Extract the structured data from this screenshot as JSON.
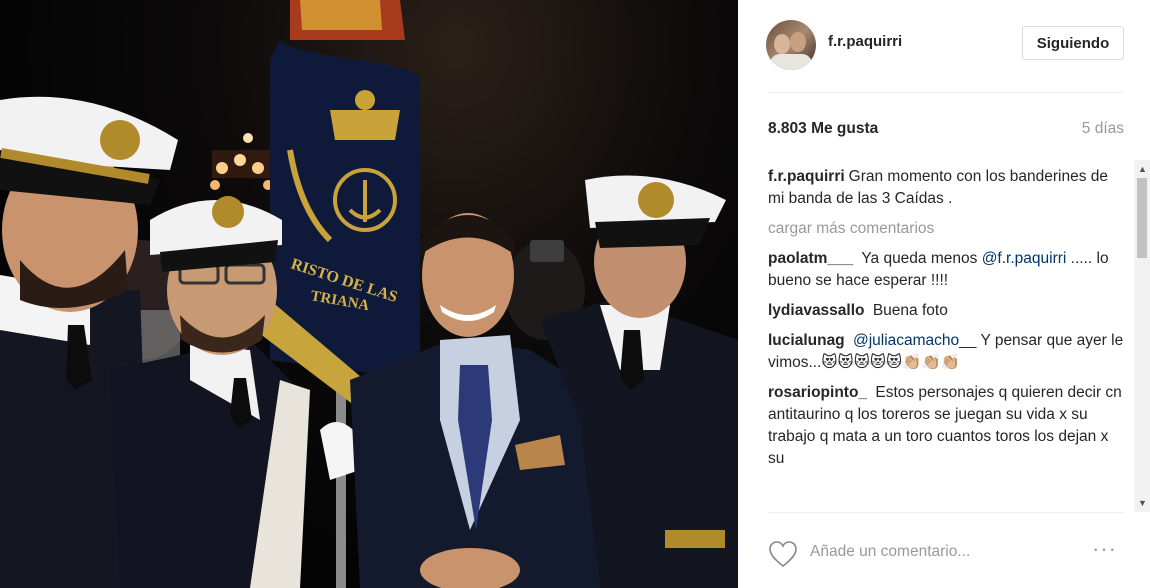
{
  "post": {
    "username": "f.r.paquirri",
    "follow_label": "Siguiendo",
    "likes": "8.803 Me gusta",
    "time": "5 días"
  },
  "caption": {
    "user": "f.r.paquirri",
    "text": "Gran momento con los banderines de mi banda de las 3 Caídas ."
  },
  "load_more": "cargar más comentarios",
  "comments": [
    {
      "user": "paolatm___",
      "before": "Ya queda menos",
      "mention": "@f.r.paquirri",
      "after": "..... lo bueno se hace esperar !!!!"
    },
    {
      "user": "lydiavassallo",
      "before": "Buena foto",
      "mention": "",
      "after": ""
    },
    {
      "user": "lucialunag",
      "before": "",
      "mention": "@juliacamacho__",
      "after": "Y pensar que ayer le vimos...😻😻😻😻😻👏🏼👏🏼👏🏼"
    },
    {
      "user": "rosariopinto_",
      "before": "Estos personajes q quieren decir cn antitaurino q los toreros se juegan su vida x su trabajo q mata a un toro cuantos toros los dejan x su",
      "mention": "",
      "after": ""
    }
  ],
  "footer": {
    "comment_placeholder": "Añade un comentario...",
    "more_label": "···"
  },
  "photo": {
    "flag_text_1": "RISTO DE LAS",
    "flag_text_2": "TRIANA"
  },
  "colors": {
    "link": "#003569",
    "muted": "#999999",
    "border": "#dbdbdb"
  }
}
